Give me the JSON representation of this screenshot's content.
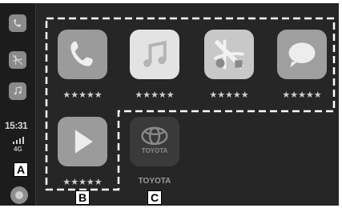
{
  "status": {
    "time": "15:31",
    "network": "4G"
  },
  "callouts": {
    "a": "A",
    "b": "B",
    "c": "C"
  },
  "apps": [
    {
      "name": "phone-app",
      "label": "★★★★★"
    },
    {
      "name": "music-app",
      "label": "★★★★★"
    },
    {
      "name": "maps-app",
      "label": "★★★★★"
    },
    {
      "name": "messages-app",
      "label": "★★★★★"
    },
    {
      "name": "now-playing-app",
      "label": "★★★★★"
    },
    {
      "name": "toyota-app",
      "label": "TOYOTA"
    }
  ],
  "toyota_logo_text": "TOYOTA",
  "colors": {
    "screen": "#262626",
    "tile": "#9a9a9a",
    "dash": "#ffffff"
  }
}
